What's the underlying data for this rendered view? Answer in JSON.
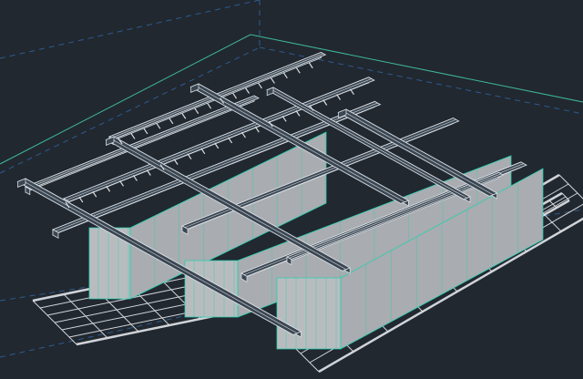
{
  "viewport": {
    "kind": "3D CAD model viewport (isometric wireframe/shaded view)",
    "colors": {
      "background": "#212830",
      "boundary_line": "#2f5b8e",
      "green_line": "#3fb59a",
      "beam_edge": "#d8dde2",
      "beam_fill": "#3a4652",
      "wall_face": "#b9bcbf",
      "wall_edge": "#25d0b0",
      "grid_line": "#e3e6ea"
    }
  }
}
